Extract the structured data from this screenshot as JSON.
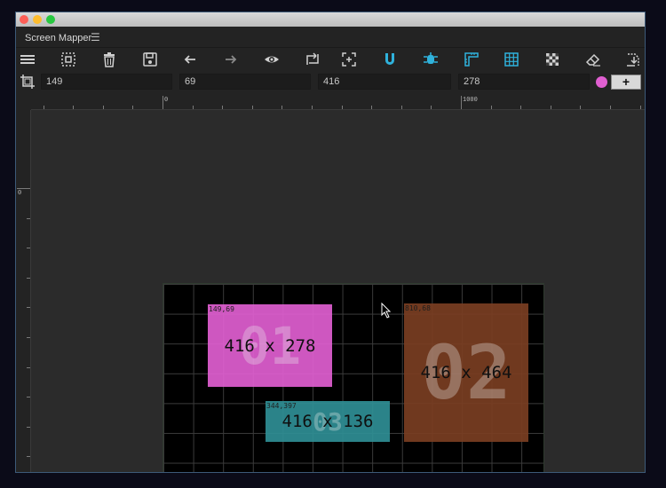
{
  "window": {
    "title": "Screen Mapper",
    "menu_icon": "hamburger-menu-icon"
  },
  "toolbar": {
    "icons": [
      "menu-icon",
      "select-region-icon",
      "trash-icon",
      "save-icon",
      "arrow-left-icon",
      "arrow-right-icon",
      "eye-icon",
      "transform-icon",
      "crosshair-icon",
      "magnet-icon",
      "bug-icon",
      "ruler-icon",
      "grid-icon",
      "checkerboard-icon",
      "eraser-icon",
      "export-icon"
    ]
  },
  "fields": {
    "x": "149",
    "y": "69",
    "width": "416",
    "height": "278"
  },
  "color": {
    "selected": "#e05fd1"
  },
  "add_button": "+",
  "ruler": {
    "top_labels": [
      "0",
      "1000"
    ],
    "left_labels": [
      "0"
    ]
  },
  "regions": [
    {
      "id": "01",
      "dims": "416 x 278",
      "coord": "149,69",
      "color": "#e05fd1"
    },
    {
      "id": "02",
      "dims": "416 x 464",
      "coord": "810,68",
      "color": "#7a3e22"
    },
    {
      "id": "03",
      "dims": "416 x 136",
      "coord": "344,397",
      "color": "#2f8f95"
    }
  ]
}
